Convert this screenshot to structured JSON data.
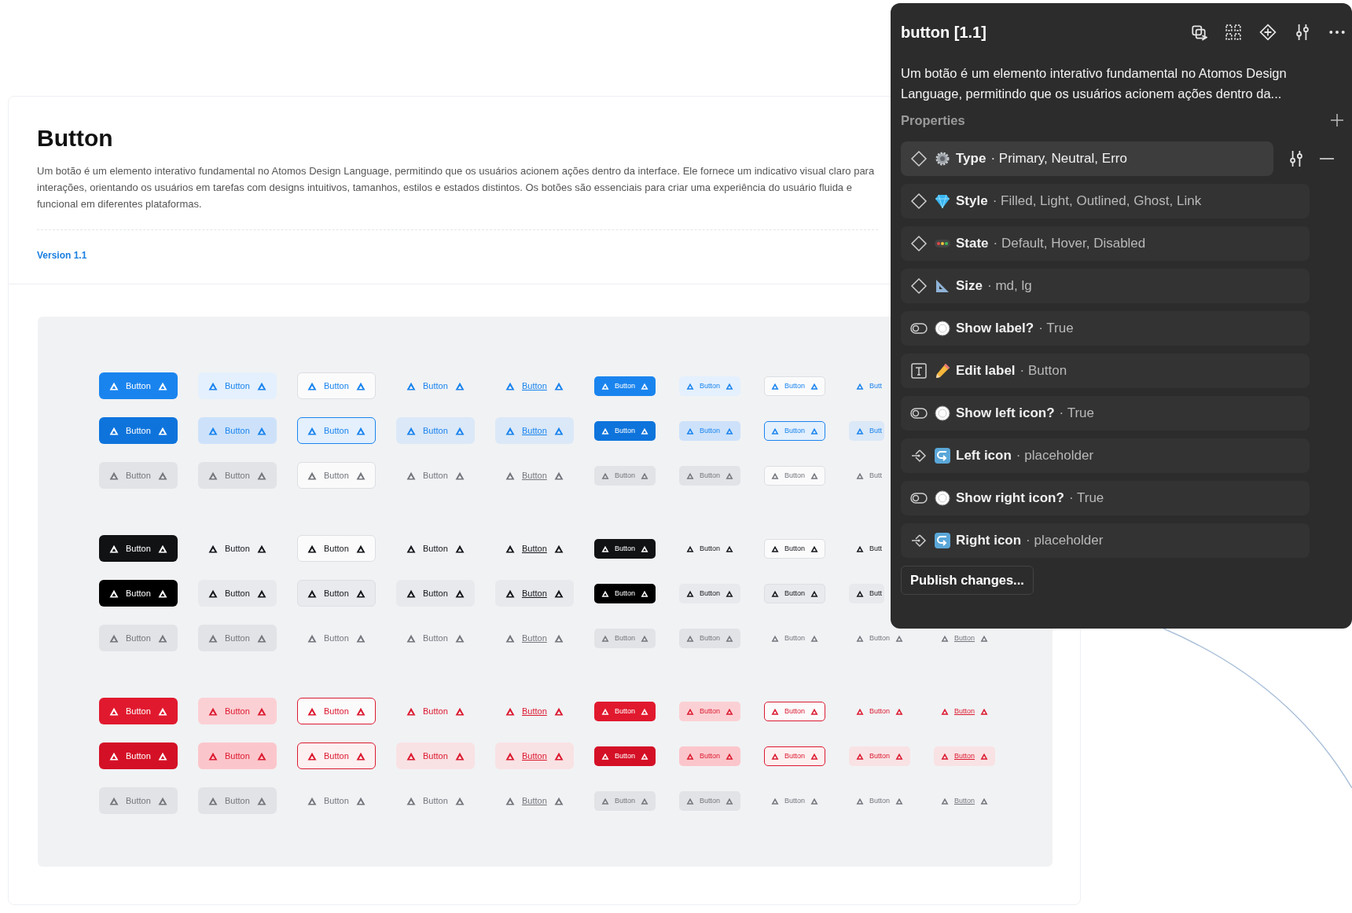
{
  "page": {
    "title": "Button",
    "description": "Um botão é um elemento interativo fundamental no Atomos Design Language, permitindo que os usuários acionem ações dentro da interface. Ele fornece um indicativo visual claro para interações, orientando os usuários em tarefas com designs intuitivos, tamanhos, estilos e estados distintos. Os botões são essenciais para criar uma experiência do usuário fluida e funcional em diferentes plataformas.",
    "version": "Version 1.1"
  },
  "showcase": {
    "groups": [
      {
        "kind": "primary",
        "rows": [
          {
            "kind": "default",
            "buttons": [
              {
                "kind": "filled",
                "label": "Button"
              },
              {
                "kind": "light",
                "label": "Button"
              },
              {
                "kind": "outlined",
                "label": "Button"
              },
              {
                "kind": "ghost",
                "label": "Button"
              },
              {
                "kind": "link",
                "label": "Button"
              },
              {
                "kind": "filled",
                "label": "Button"
              },
              {
                "kind": "light",
                "label": "Button"
              },
              {
                "kind": "outlined",
                "label": "Button"
              },
              {
                "kind": "ghost",
                "label": "Butt",
                "right_icon": false
              }
            ]
          },
          {
            "kind": "hover",
            "buttons": [
              {
                "kind": "filled",
                "label": "Button"
              },
              {
                "kind": "light",
                "label": "Button"
              },
              {
                "kind": "outlined",
                "label": "Button"
              },
              {
                "kind": "ghost",
                "label": "Button"
              },
              {
                "kind": "link",
                "label": "Button"
              },
              {
                "kind": "filled",
                "label": "Button"
              },
              {
                "kind": "light",
                "label": "Button"
              },
              {
                "kind": "outlined",
                "label": "Button"
              },
              {
                "kind": "ghost",
                "label": "Butt",
                "right_icon": false
              }
            ]
          },
          {
            "kind": "disabled",
            "buttons": [
              {
                "kind": "filled",
                "label": "Button"
              },
              {
                "kind": "light",
                "label": "Button"
              },
              {
                "kind": "outlined",
                "label": "Button"
              },
              {
                "kind": "ghost",
                "label": "Button"
              },
              {
                "kind": "link",
                "label": "Button"
              },
              {
                "kind": "filled",
                "label": "Button"
              },
              {
                "kind": "light",
                "label": "Button"
              },
              {
                "kind": "outlined",
                "label": "Button"
              },
              {
                "kind": "ghost",
                "label": "Butt",
                "right_icon": false
              }
            ]
          }
        ]
      },
      {
        "kind": "neutral",
        "rows": [
          {
            "kind": "default",
            "buttons": [
              {
                "kind": "filled",
                "label": "Button"
              },
              {
                "kind": "light",
                "label": "Button"
              },
              {
                "kind": "outlined",
                "label": "Button"
              },
              {
                "kind": "ghost",
                "label": "Button"
              },
              {
                "kind": "link",
                "label": "Button"
              },
              {
                "kind": "filled",
                "label": "Button"
              },
              {
                "kind": "light",
                "label": "Button"
              },
              {
                "kind": "outlined",
                "label": "Button"
              },
              {
                "kind": "ghost",
                "label": "Butt",
                "right_icon": false
              }
            ]
          },
          {
            "kind": "hover",
            "buttons": [
              {
                "kind": "filled",
                "label": "Button"
              },
              {
                "kind": "light",
                "label": "Button"
              },
              {
                "kind": "outlined",
                "label": "Button"
              },
              {
                "kind": "ghost",
                "label": "Button"
              },
              {
                "kind": "link",
                "label": "Button"
              },
              {
                "kind": "filled",
                "label": "Button"
              },
              {
                "kind": "light",
                "label": "Button"
              },
              {
                "kind": "outlined",
                "label": "Button"
              },
              {
                "kind": "ghost",
                "label": "Butt",
                "right_icon": false
              }
            ]
          },
          {
            "kind": "disabled",
            "buttons": [
              {
                "kind": "filled",
                "label": "Button"
              },
              {
                "kind": "light",
                "label": "Button"
              },
              {
                "kind": "outlined",
                "label": "Button"
              },
              {
                "kind": "ghost",
                "label": "Button"
              },
              {
                "kind": "link",
                "label": "Button"
              },
              {
                "kind": "filled",
                "label": "Button"
              },
              {
                "kind": "light",
                "label": "Button"
              },
              {
                "kind": "outlined",
                "label": "Button"
              },
              {
                "kind": "ghost",
                "label": "Button"
              },
              {
                "kind": "link",
                "label": "Button"
              }
            ]
          }
        ]
      },
      {
        "kind": "error",
        "rows": [
          {
            "kind": "default",
            "buttons": [
              {
                "kind": "filled",
                "label": "Button"
              },
              {
                "kind": "light",
                "label": "Button"
              },
              {
                "kind": "outlined",
                "label": "Button"
              },
              {
                "kind": "ghost",
                "label": "Button"
              },
              {
                "kind": "link",
                "label": "Button"
              },
              {
                "kind": "filled",
                "label": "Button"
              },
              {
                "kind": "light",
                "label": "Button"
              },
              {
                "kind": "outlined",
                "label": "Button"
              },
              {
                "kind": "ghost",
                "label": "Button"
              },
              {
                "kind": "link",
                "label": "Button"
              }
            ]
          },
          {
            "kind": "hover",
            "buttons": [
              {
                "kind": "filled",
                "label": "Button"
              },
              {
                "kind": "light",
                "label": "Button"
              },
              {
                "kind": "outlined",
                "label": "Button"
              },
              {
                "kind": "ghost",
                "label": "Button"
              },
              {
                "kind": "link",
                "label": "Button"
              },
              {
                "kind": "filled",
                "label": "Button"
              },
              {
                "kind": "light",
                "label": "Button"
              },
              {
                "kind": "outlined",
                "label": "Button"
              },
              {
                "kind": "ghost",
                "label": "Button"
              },
              {
                "kind": "link",
                "label": "Button"
              }
            ]
          },
          {
            "kind": "disabled",
            "buttons": [
              {
                "kind": "filled",
                "label": "Button"
              },
              {
                "kind": "light",
                "label": "Button"
              },
              {
                "kind": "outlined",
                "label": "Button"
              },
              {
                "kind": "ghost",
                "label": "Button"
              },
              {
                "kind": "link",
                "label": "Button"
              },
              {
                "kind": "filled",
                "label": "Button"
              },
              {
                "kind": "light",
                "label": "Button"
              },
              {
                "kind": "outlined",
                "label": "Button"
              },
              {
                "kind": "ghost",
                "label": "Button"
              },
              {
                "kind": "link",
                "label": "Button"
              }
            ]
          }
        ]
      }
    ]
  },
  "panel": {
    "title": "button [1.1]",
    "description": "Um botão é um elemento interativo fundamental no Atomos Design Language, permitindo que os usuários acionem ações dentro da...",
    "section": "Properties",
    "properties": [
      {
        "kind": "variant",
        "name": "Type",
        "value": "· Primary, Neutral, Erro",
        "selected": true
      },
      {
        "kind": "variant",
        "name": "Style",
        "value": "· Filled, Light, Outlined, Ghost, Link",
        "selected": false
      },
      {
        "kind": "variant",
        "name": "State",
        "value": "· Default, Hover, Disabled",
        "selected": false
      },
      {
        "kind": "variant",
        "name": "Size",
        "value": "· md, lg",
        "selected": false
      },
      {
        "kind": "boolean",
        "name": "Show label?",
        "value": "· True",
        "selected": false
      },
      {
        "kind": "text",
        "name": "Edit label",
        "value": "· Button",
        "selected": false
      },
      {
        "kind": "boolean",
        "name": "Show left icon?",
        "value": "· True",
        "selected": false
      },
      {
        "kind": "instance",
        "name": "Left icon",
        "value": "· placeholder",
        "selected": false
      },
      {
        "kind": "boolean",
        "name": "Show right icon?",
        "value": "· True",
        "selected": false
      },
      {
        "kind": "instance",
        "name": "Right icon",
        "value": "· placeholder",
        "selected": false
      }
    ],
    "publish": "Publish changes..."
  }
}
